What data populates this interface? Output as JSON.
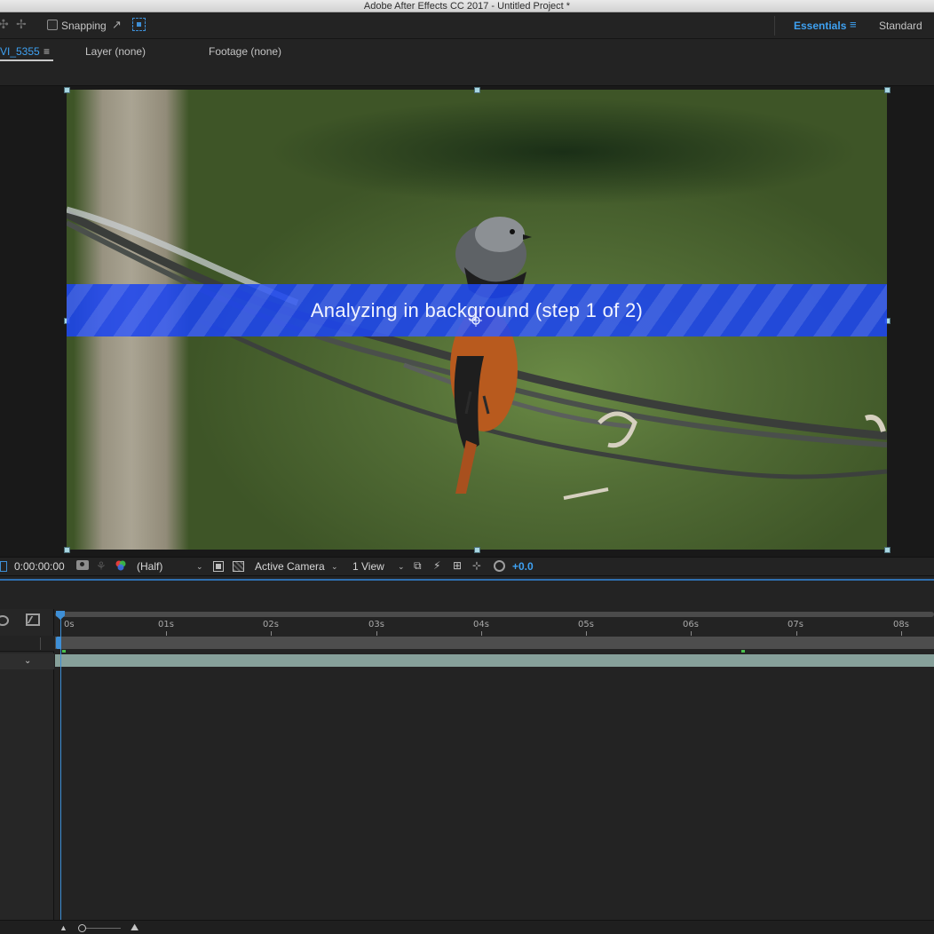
{
  "window": {
    "title": "Adobe After Effects CC 2017 - Untitled Project *"
  },
  "toolbar": {
    "snapping_label": "Snapping",
    "workspaces": {
      "active": "Essentials",
      "menu_icon": "≡",
      "other": "Standard"
    }
  },
  "panels": {
    "composition_tab": "VI_5355",
    "composition_menu_icon": "≡",
    "layer_tab": "Layer (none)",
    "footage_tab": "Footage (none)"
  },
  "viewer": {
    "banner_text": "Analyzing in background (step 1 of 2)",
    "banner_color": "#1c46f0"
  },
  "viewer_controls": {
    "timecode": "0:00:00:00",
    "resolution": "(Half)",
    "camera": "Active Camera",
    "views": "1 View",
    "exposure": "+0.0",
    "accent_color": "#3ea1f2"
  },
  "timeline": {
    "ruler_labels": [
      "0s",
      "01s",
      "02s",
      "03s",
      "04s",
      "05s",
      "06s",
      "07s",
      "08s"
    ],
    "layer_bar_color": "#91aea7"
  }
}
